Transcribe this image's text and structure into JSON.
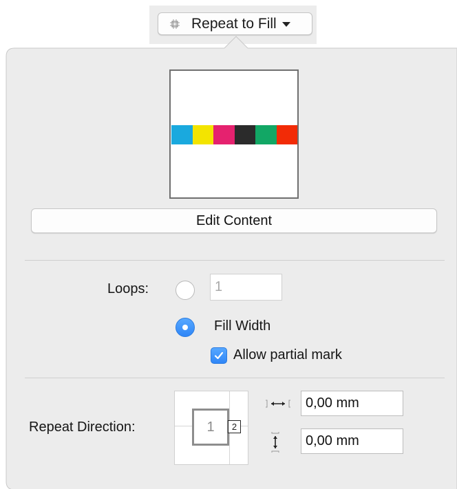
{
  "dropdown": {
    "label": "Repeat to Fill",
    "icon": "repeat-fill-icon"
  },
  "preview": {
    "swatches": [
      "#1aa9de",
      "#f3e400",
      "#e5226f",
      "#2b2b2b",
      "#12a765",
      "#f22b06"
    ]
  },
  "edit_button": {
    "label": "Edit Content"
  },
  "loops": {
    "label": "Loops:",
    "value": "1",
    "selected": false
  },
  "fill_width": {
    "label": "Fill Width",
    "selected": true
  },
  "allow_partial": {
    "label": "Allow partial mark",
    "checked": true
  },
  "repeat_direction": {
    "label": "Repeat Direction:",
    "tile_primary": "1",
    "tile_secondary": "2",
    "horizontal_gap": {
      "icon": "horizontal-gap-icon",
      "value": "0,00 mm"
    },
    "vertical_gap": {
      "icon": "vertical-gap-icon",
      "value": "0,00 mm"
    }
  },
  "colors": {
    "accent": "#2f86f7",
    "panel": "#ececec"
  }
}
